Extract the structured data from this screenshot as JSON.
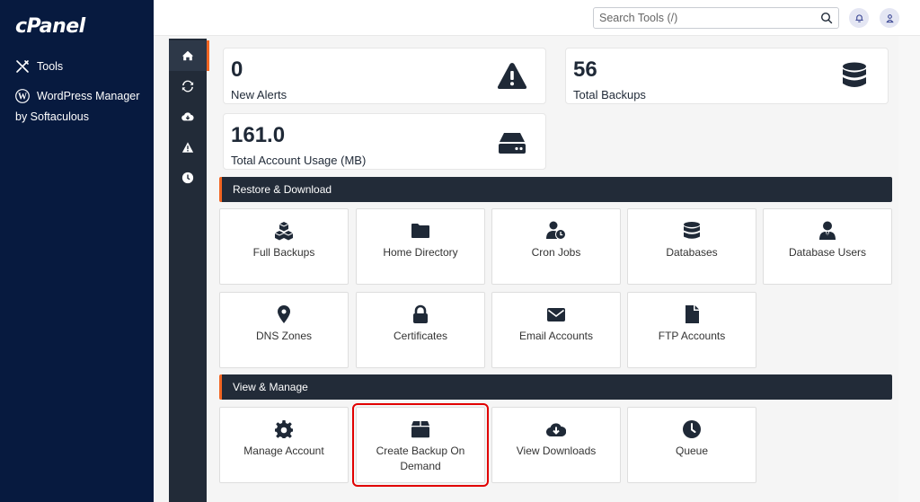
{
  "sidebar": {
    "logo": "cPanel",
    "items": [
      {
        "label": "Tools",
        "icon": "tools-icon"
      },
      {
        "label": "WordPress Manager",
        "sub": "by Softaculous",
        "icon": "wordpress-icon"
      }
    ]
  },
  "header": {
    "search_placeholder": "Search Tools (/)",
    "search_value": "",
    "icons": [
      "search-icon",
      "bell-icon",
      "user-icon"
    ]
  },
  "rail": {
    "items": [
      {
        "name": "home",
        "icon": "home-icon",
        "active": true
      },
      {
        "name": "restore",
        "icon": "sync-icon",
        "active": false
      },
      {
        "name": "download",
        "icon": "cloud-download-icon",
        "active": false
      },
      {
        "name": "alerts",
        "icon": "warning-icon",
        "active": false
      },
      {
        "name": "history",
        "icon": "clock-icon",
        "active": false
      }
    ]
  },
  "stats": {
    "alerts": {
      "value": "0",
      "label": "New Alerts",
      "icon": "warning-icon"
    },
    "backups": {
      "value": "56",
      "label": "Total Backups",
      "icon": "database-icon"
    },
    "usage": {
      "value": "161.0",
      "label": "Total Account Usage (MB)",
      "icon": "hard-drive-icon"
    }
  },
  "sections": {
    "restore": {
      "title": "Restore & Download",
      "tiles": [
        {
          "label": "Full Backups",
          "icon": "cubes-icon"
        },
        {
          "label": "Home Directory",
          "icon": "folder-icon"
        },
        {
          "label": "Cron Jobs",
          "icon": "user-clock-icon"
        },
        {
          "label": "Databases",
          "icon": "database-icon"
        },
        {
          "label": "Database Users",
          "icon": "user-tie-icon"
        },
        {
          "label": "DNS Zones",
          "icon": "map-marker-icon"
        },
        {
          "label": "Certificates",
          "icon": "lock-icon"
        },
        {
          "label": "Email Accounts",
          "icon": "envelope-icon"
        },
        {
          "label": "FTP Accounts",
          "icon": "file-icon"
        }
      ]
    },
    "view": {
      "title": "View & Manage",
      "tiles": [
        {
          "label": "Manage Account",
          "icon": "gear-icon"
        },
        {
          "label": "Create Backup On Demand",
          "icon": "box-icon",
          "highlighted": true
        },
        {
          "label": "View Downloads",
          "icon": "cloud-download-icon"
        },
        {
          "label": "Queue",
          "icon": "clock-icon"
        }
      ]
    }
  },
  "colors": {
    "sidebar_bg": "#071a3f",
    "rail_bg": "#222b38",
    "accent": "#f26522",
    "highlight": "#e10000",
    "icon": "#1f2937"
  }
}
